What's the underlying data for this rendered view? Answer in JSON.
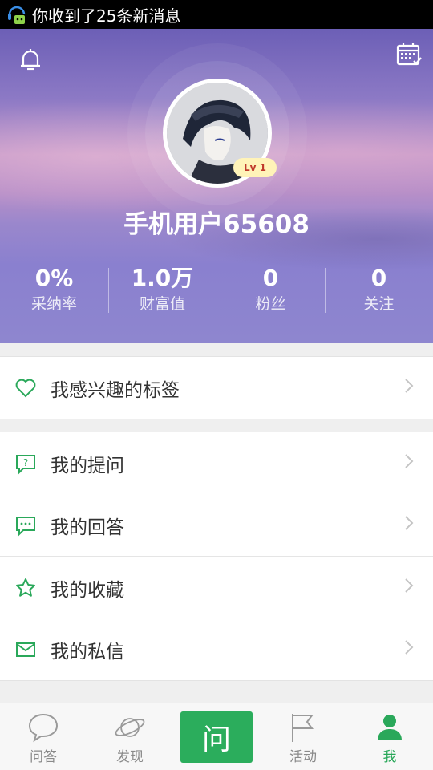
{
  "status_bar": {
    "notification": "你收到了25条新消息"
  },
  "profile": {
    "username": "手机用户65608",
    "level": "Lv 1",
    "stats": [
      {
        "value": "0%",
        "label": "采纳率"
      },
      {
        "value": "1.0万",
        "label": "财富值"
      },
      {
        "value": "0",
        "label": "粉丝"
      },
      {
        "value": "0",
        "label": "关注"
      }
    ]
  },
  "menu": {
    "interests": "我感兴趣的标签",
    "questions": "我的提问",
    "answers": "我的回答",
    "favorites": "我的收藏",
    "messages": "我的私信"
  },
  "tabbar": {
    "qa": "问答",
    "discover": "发现",
    "ask": "问",
    "activity": "活动",
    "me": "我"
  },
  "colors": {
    "accent": "#2aa85a",
    "header": "#8a80cf"
  }
}
